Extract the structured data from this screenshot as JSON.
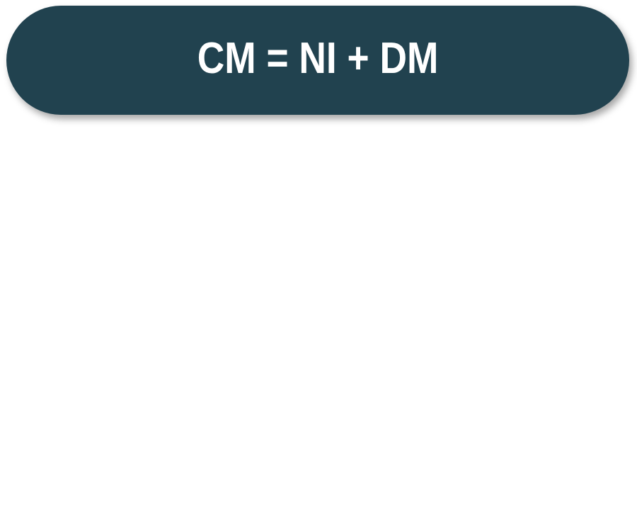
{
  "banner": {
    "formula": "CM = NI + DM",
    "background_color": "#21424f",
    "text_color": "#ffffff"
  }
}
